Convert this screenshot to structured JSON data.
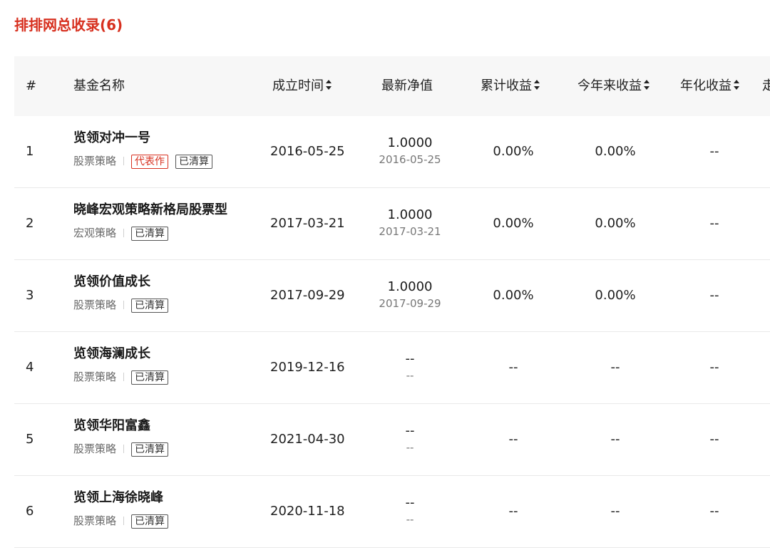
{
  "title": "排排网总收录(6)",
  "columns": {
    "index": "#",
    "name": "基金名称",
    "founded": "成立时间",
    "nav": "最新净值",
    "cumulative": "累计收益",
    "ytd": "今年来收益",
    "annualized": "年化收益",
    "trend": "走"
  },
  "rows": [
    {
      "index": "1",
      "name": "览领对冲一号",
      "strategy": "股票策略",
      "tags": [
        "代表作",
        "已清算"
      ],
      "founded": "2016-05-25",
      "nav": "1.0000",
      "nav_date": "2016-05-25",
      "cumulative": "0.00%",
      "ytd": "0.00%",
      "annualized": "--"
    },
    {
      "index": "2",
      "name": "晓峰宏观策略新格局股票型",
      "strategy": "宏观策略",
      "tags": [
        "已清算"
      ],
      "founded": "2017-03-21",
      "nav": "1.0000",
      "nav_date": "2017-03-21",
      "cumulative": "0.00%",
      "ytd": "0.00%",
      "annualized": "--"
    },
    {
      "index": "3",
      "name": "览领价值成长",
      "strategy": "股票策略",
      "tags": [
        "已清算"
      ],
      "founded": "2017-09-29",
      "nav": "1.0000",
      "nav_date": "2017-09-29",
      "cumulative": "0.00%",
      "ytd": "0.00%",
      "annualized": "--"
    },
    {
      "index": "4",
      "name": "览领海澜成长",
      "strategy": "股票策略",
      "tags": [
        "已清算"
      ],
      "founded": "2019-12-16",
      "nav": "--",
      "nav_date": "--",
      "cumulative": "--",
      "ytd": "--",
      "annualized": "--"
    },
    {
      "index": "5",
      "name": "览领华阳富鑫",
      "strategy": "股票策略",
      "tags": [
        "已清算"
      ],
      "founded": "2021-04-30",
      "nav": "--",
      "nav_date": "--",
      "cumulative": "--",
      "ytd": "--",
      "annualized": "--"
    },
    {
      "index": "6",
      "name": "览领上海徐晓峰",
      "strategy": "股票策略",
      "tags": [
        "已清算"
      ],
      "founded": "2020-11-18",
      "nav": "--",
      "nav_date": "--",
      "cumulative": "--",
      "ytd": "--",
      "annualized": "--"
    }
  ],
  "colors": {
    "accent": "#d7301f",
    "header_bg": "#f7f7f7",
    "row_border": "#e9e9e9"
  }
}
